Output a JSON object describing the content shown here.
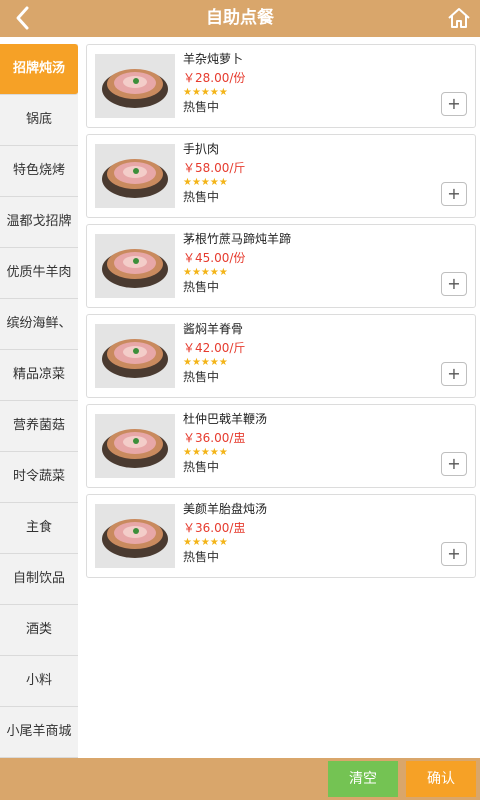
{
  "header": {
    "title": "自助点餐",
    "back_icon": "chevron-left-icon",
    "home_icon": "home-icon"
  },
  "sidebar": {
    "active_color": "#f6a126",
    "items": [
      {
        "label": "招牌炖汤"
      },
      {
        "label": "锅底"
      },
      {
        "label": "特色烧烤"
      },
      {
        "label": "温都戈招牌"
      },
      {
        "label": "优质牛羊肉"
      },
      {
        "label": "缤纷海鲜、"
      },
      {
        "label": "精品凉菜"
      },
      {
        "label": "营养菌菇"
      },
      {
        "label": "时令蔬菜"
      },
      {
        "label": "主食"
      },
      {
        "label": "自制饮品"
      },
      {
        "label": "酒类"
      },
      {
        "label": "小料"
      },
      {
        "label": "小尾羊商城"
      }
    ]
  },
  "products": [
    {
      "name": "羊杂炖萝卜",
      "price": "￥28.00/份",
      "rating": 5,
      "status": "热售中",
      "add_label": "+"
    },
    {
      "name": "手扒肉",
      "price": "￥58.00/斤",
      "rating": 5,
      "status": "热售中",
      "add_label": "+"
    },
    {
      "name": "茅根竹蔗马蹄炖羊蹄",
      "price": "￥45.00/份",
      "rating": 5,
      "status": "热售中",
      "add_label": "+"
    },
    {
      "name": "酱焖羊脊骨",
      "price": "￥42.00/斤",
      "rating": 5,
      "status": "热售中",
      "add_label": "+"
    },
    {
      "name": "杜仲巴戟羊鞭汤",
      "price": "￥36.00/盅",
      "rating": 5,
      "status": "热售中",
      "add_label": "+"
    },
    {
      "name": "美颜羊胎盘炖汤",
      "price": "￥36.00/盅",
      "rating": 5,
      "status": "热售中",
      "add_label": "+"
    }
  ],
  "footer": {
    "clear_label": "清空",
    "confirm_label": "确认",
    "clear_color": "#74c353",
    "confirm_color": "#f6a126"
  }
}
